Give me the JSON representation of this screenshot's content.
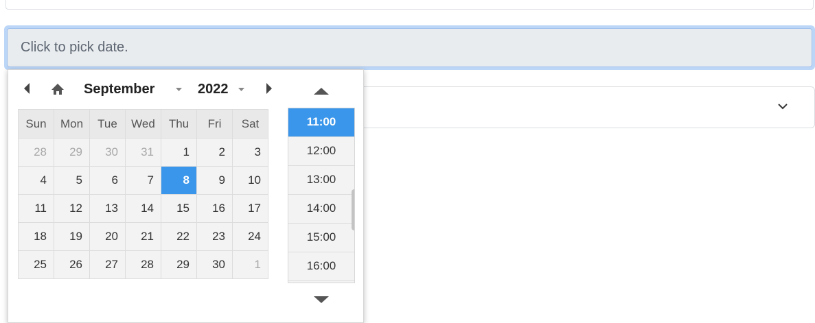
{
  "date_input": {
    "placeholder": "Click to pick date."
  },
  "picker": {
    "month": "September",
    "year": "2022",
    "weekdays": [
      "Sun",
      "Mon",
      "Tue",
      "Wed",
      "Thu",
      "Fri",
      "Sat"
    ],
    "weeks": [
      [
        {
          "d": "28",
          "o": true
        },
        {
          "d": "29",
          "o": true
        },
        {
          "d": "30",
          "o": true
        },
        {
          "d": "31",
          "o": true
        },
        {
          "d": "1"
        },
        {
          "d": "2"
        },
        {
          "d": "3"
        }
      ],
      [
        {
          "d": "4"
        },
        {
          "d": "5"
        },
        {
          "d": "6"
        },
        {
          "d": "7"
        },
        {
          "d": "8",
          "s": true
        },
        {
          "d": "9"
        },
        {
          "d": "10"
        }
      ],
      [
        {
          "d": "11"
        },
        {
          "d": "12"
        },
        {
          "d": "13"
        },
        {
          "d": "14"
        },
        {
          "d": "15"
        },
        {
          "d": "16"
        },
        {
          "d": "17"
        }
      ],
      [
        {
          "d": "18"
        },
        {
          "d": "19"
        },
        {
          "d": "20"
        },
        {
          "d": "21"
        },
        {
          "d": "22"
        },
        {
          "d": "23"
        },
        {
          "d": "24"
        }
      ],
      [
        {
          "d": "25"
        },
        {
          "d": "26"
        },
        {
          "d": "27"
        },
        {
          "d": "28"
        },
        {
          "d": "29"
        },
        {
          "d": "30"
        },
        {
          "d": "1",
          "o": true
        }
      ]
    ],
    "times": [
      "11:00",
      "12:00",
      "13:00",
      "14:00",
      "15:00",
      "16:00"
    ],
    "selected_time": "11:00"
  },
  "colors": {
    "accent": "#3a96ea",
    "input_bg": "#e9ecef",
    "focus_ring": "#bcd6f7"
  },
  "icons": {
    "prev": "triangle-left-icon",
    "home": "home-icon",
    "next": "triangle-right-icon",
    "time_up": "triangle-up-icon",
    "time_down": "triangle-down-icon",
    "select": "chevron-down-icon"
  }
}
